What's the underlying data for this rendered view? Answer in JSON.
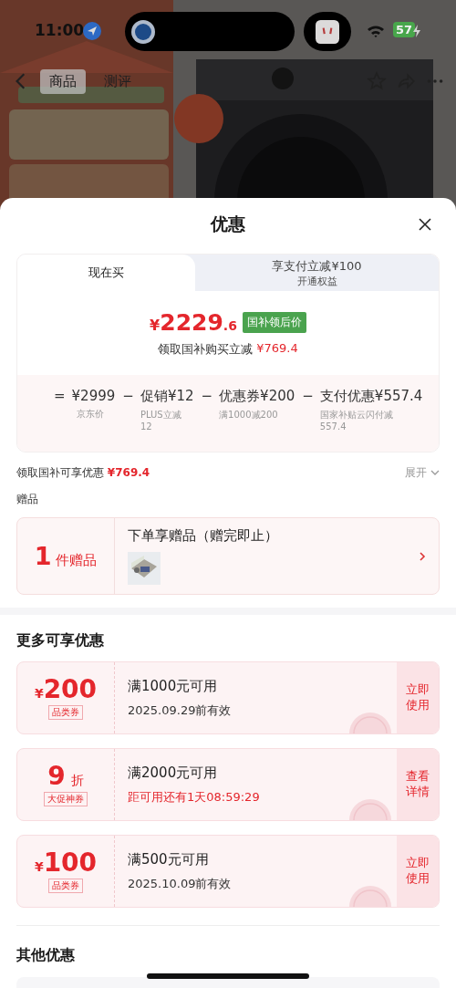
{
  "status_bar": {
    "time": "11:00",
    "battery": "57"
  },
  "nav": {
    "tabs": [
      {
        "label": "商品",
        "selected": true
      },
      {
        "label": "测评",
        "selected": false
      }
    ]
  },
  "sheet": {
    "title": "优惠"
  },
  "price_tabs": [
    {
      "label": "现在买",
      "selected": true
    },
    {
      "label": "享支付立减¥100",
      "sublabel": "开通权益",
      "selected": false
    }
  ],
  "price": {
    "currency": "¥",
    "integer": "2229",
    "decimal": ".6",
    "badge": "国补领后价",
    "note": "领取国补购买立减",
    "note_amount": "¥769.4"
  },
  "breakdown": [
    {
      "op": "=",
      "amount": "¥2999",
      "caption": "京东价"
    },
    {
      "op": "−",
      "amount": "促销¥12",
      "caption": "PLUS立减12"
    },
    {
      "op": "−",
      "amount": "优惠券¥200",
      "caption": "满1000减200"
    },
    {
      "op": "−",
      "amount": "支付优惠¥557.4",
      "caption": "国家补贴云闪付减557.4"
    }
  ],
  "discount_summary": {
    "label": "领取国补可享优惠",
    "amount": "¥769.4",
    "toggle": "展开",
    "expanded": false
  },
  "gifts": {
    "title": "赠品",
    "count": "1",
    "unit": "件赠品",
    "text": "下单享赠品（赠完即止）"
  },
  "more_offers": {
    "title": "更多可享优惠",
    "coupons": [
      {
        "kind": "amount",
        "currency": "¥",
        "value": "200",
        "tag": "品类券",
        "condition": "满1000元可用",
        "detail": "2025.09.29前有效",
        "highlight": false,
        "action": "立即使用"
      },
      {
        "kind": "discount",
        "value": "9",
        "unit": "折",
        "tag": "大促神券",
        "condition": "满2000元可用",
        "detail": "距可用还有1天08:59:29",
        "highlight": true,
        "action": "查看详情"
      },
      {
        "kind": "amount",
        "currency": "¥",
        "value": "100",
        "tag": "品类券",
        "condition": "满500元可用",
        "detail": "2025.10.09前有效",
        "highlight": false,
        "action": "立即使用"
      }
    ]
  },
  "other_offers": {
    "title": "其他优惠"
  }
}
